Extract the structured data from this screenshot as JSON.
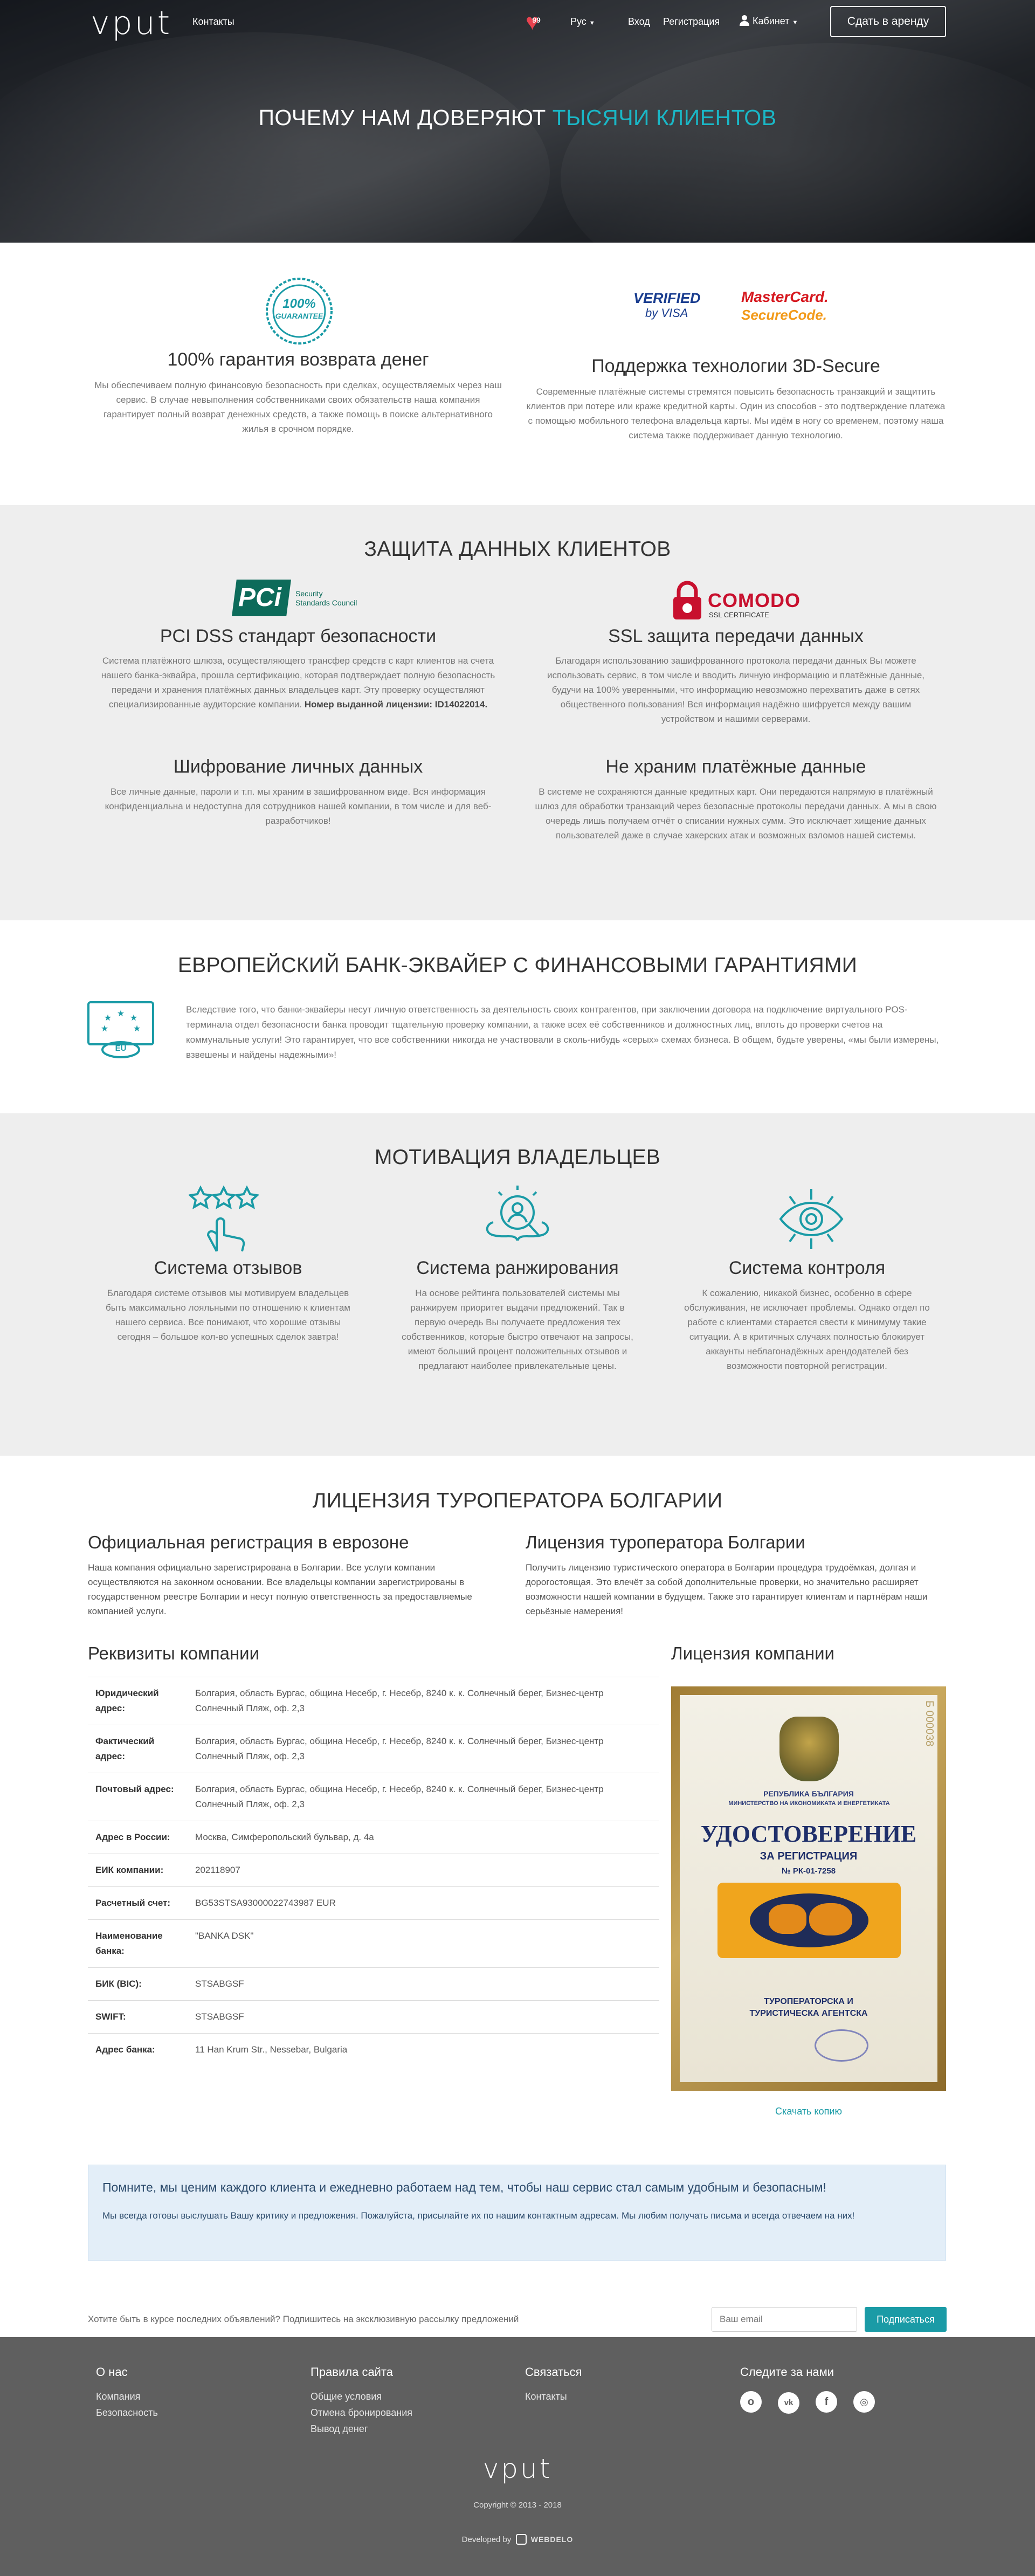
{
  "nav": {
    "logo": "vput",
    "contacts": "Контакты",
    "favorites_count": "99",
    "language": "Рус",
    "login": "Вход",
    "register": "Регистрация",
    "cabinet": "Кабинет",
    "rent_button": "Сдать в аренду"
  },
  "hero": {
    "title_main": "ПОЧЕМУ НАМ ДОВЕРЯЮТ ",
    "title_accent": "ТЫСЯЧИ КЛИЕНТОВ"
  },
  "guarantee": {
    "badge_top": "100%",
    "badge_bottom": "GUARANTEE",
    "title": "100% гарантия возврата денег",
    "text": "Мы обеспечиваем полную финансовую безопасность при сделках, осуществляемых через наш сервис. В случае невыполнения собственниками своих обязательств наша компания гарантирует полный возврат денежных средств, а также помощь в поиске альтернативного жилья в срочном порядке."
  },
  "secure3d": {
    "visa_line1": "VERIFIED",
    "visa_line2": "by VISA",
    "mc_line1": "MasterCard.",
    "mc_line2": "SecureCode.",
    "title": "Поддержка технологии 3D-Secure",
    "text": "Современные платёжные системы стремятся повысить безопасность транзакций и защитить клиентов при потере или краже кредитной карты. Один из способов - это подтверждение платежа с помощью мобильного телефона владельца карты. Мы идём в ногу со временем, поэтому наша система также поддерживает данную технологию."
  },
  "protection": {
    "title": "ЗАЩИТА ДАННЫХ КЛИЕНТОВ",
    "pci_logo": "PCi",
    "pci_sub1": "Security",
    "pci_sub2": "Standards Council",
    "pci_title": "PCI DSS стандарт безопасности",
    "pci_text": "Система платёжного шлюза, осуществляющего трансфер средств с карт клиентов на счета нашего банка-эквайра, прошла сертификацию, которая подтверждает полную безопасность передачи и хранения платёжных данных владельцев карт. Эту проверку осуществляют специализированные аудиторские компании.",
    "pci_license_label": "Номер выданной лицензии: ID14022014.",
    "comodo_logo": "COMODO",
    "comodo_sub": "SSL CERTIFICATE",
    "ssl_title": "SSL защита передачи данных",
    "ssl_text": "Благодаря использованию зашифрованного протокола передачи данных Вы можете использовать сервис, в том числе и вводить личную информацию и платёжные данные, будучи на 100% уверенными, что информацию невозможно перехватить даже в сетях общественного пользования! Вся информация надёжно шифруется между вашим устройством и нашими серверами.",
    "enc_title": "Шифрование личных данных",
    "enc_text": "Все личные данные, пароли и т.п. мы храним в зашифрованном виде. Вся информация конфиденциальна и недоступна для сотрудников нашей компании, в том числе и для веб-разработчиков!",
    "nostore_title": "Не храним платёжные данные",
    "nostore_text": "В системе не сохраняются данные кредитных карт. Они передаются напрямую в платёжный шлюз для обработки транзакций через безопасные протоколы передачи данных. А мы в свою очередь лишь получаем отчёт о списании нужных сумм. Это исключает хищение данных пользователей даже в случае хакерских атак и возможных взломов нашей системы."
  },
  "bank": {
    "title": "ЕВРОПЕЙСКИЙ БАНК-ЭКВАЙЕР С ФИНАНСОВЫМИ ГАРАНТИЯМИ",
    "eu_label": "EU",
    "text": "Вследствие того, что банки-эквайеры несут личную ответственность за деятельность своих контрагентов, при заключении договора на подключение виртуального POS-терминала отдел безопасности банка проводит тщательную проверку компании, а также всех её собственников и должностных лиц, вплоть до проверки счетов на коммунальные услуги! Это гарантирует, что все собственники никогда не участвовали в сколь-нибудь «серых» схемах бизнеса. В общем, будьте уверены, «мы были измерены, взвешены и найдены надежными»!"
  },
  "motivation": {
    "title": "МОТИВАЦИЯ ВЛАДЕЛЬЦЕВ",
    "items": [
      {
        "title": "Система отзывов",
        "text": "Благодаря системе отзывов мы мотивируем владельцев быть максимально лояльными по отношению к клиентам нашего сервиса. Все понимают, что хорошие отзывы сегодня – большое кол-во успешных сделок завтра!"
      },
      {
        "title": "Система ранжирования",
        "text": "На основе рейтинга пользователей системы мы ранжируем приоритет выдачи предложений. Так в первую очередь Вы получаете предложения тех собственников, которые быстро отвечают на запросы, имеют больший процент положительных отзывов и предлагают наиболее привлекательные цены."
      },
      {
        "title": "Система контроля",
        "text": "К сожалению, никакой бизнес, особенно в сфере обслуживания, не исключает проблемы. Однако отдел по работе с клиентами старается свести к минимуму такие ситуации. А в критичных случаях полностью блокирует аккаунты неблагонадёжных арендодателей без возможности повторной регистрации."
      }
    ]
  },
  "license": {
    "title": "ЛИЦЕНЗИЯ ТУРОПЕРАТОРА БОЛГАРИИ",
    "reg_title": "Официальная регистрация в еврозоне",
    "reg_text": "Наша компания официально зарегистрирована в Болгарии. Все услуги компании осуществляются на законном основании. Все владельцы компании зарегистрированы в государственном реестре Болгарии и несут полную ответственность за предоставляемые компанией услуги.",
    "op_title": "Лицензия туроператора Болгарии",
    "op_text": "Получить лицензию туристического оператора в Болгарии процедура трудоёмкая, долгая и дорогостоящая. Это влечёт за собой дополнительные проверки, но значительно расширяет возможности нашей компании в будущем. Также это гарантирует клиентам и партнёрам наши серьёзные намерения!",
    "req_title": "Реквизиты компании",
    "req_rows": [
      {
        "k": "Юридический адрес:",
        "v": "Болгария, область Бургас, община Несебр, г. Несебр, 8240 к. к. Солнечный берег, Бизнес-центр Солнечный Пляж, оф. 2,3"
      },
      {
        "k": "Фактический адрес:",
        "v": "Болгария, область Бургас, община Несебр, г. Несебр, 8240 к. к. Солнечный берег, Бизнес-центр Солнечный Пляж, оф. 2,3"
      },
      {
        "k": "Почтовый адрес:",
        "v": "Болгария, область Бургас, община Несебр, г. Несебр, 8240 к. к. Солнечный берег, Бизнес-центр Солнечный Пляж, оф. 2,3"
      },
      {
        "k": "Адрес в России:",
        "v": "Москва, Симферопольский бульвар, д. 4а"
      },
      {
        "k": "ЕИК компании:",
        "v": "202118907"
      },
      {
        "k": "Расчетный счет:",
        "v": "BG53STSA93000022743987 EUR"
      },
      {
        "k": "Наименование банка:",
        "v": "\"BANKA DSK\""
      },
      {
        "k": "БИК (BIC):",
        "v": "STSABGSF"
      },
      {
        "k": "SWIFT:",
        "v": "STSABGSF"
      },
      {
        "k": "Адрес банка:",
        "v": "11 Han Krum Str., Nessebar, Bulgaria"
      }
    ],
    "lic_title": "Лицензия компании",
    "doc_line1": "РЕПУБЛИКА БЪЛГАРИЯ",
    "doc_line2": "МИНИСТЕРСТВО НА ИКОНОМИКАТА И ЕНЕРГЕТИКАТА",
    "doc_heading": "УДОСТОВЕРЕНИЕ",
    "doc_sub": "ЗА РЕГИСТРАЦИЯ",
    "doc_num": "№ РК-01-7258",
    "doc_type1": "ТУРОПЕРАТОРСКА И",
    "doc_type2": "ТУРИСТИЧЕСКА АГЕНТСКА",
    "doc_serial": "Б 000038",
    "download": "Скачать копию"
  },
  "notice": {
    "title": "Помните, мы ценим каждого клиента и ежедневно работаем над тем, чтобы наш сервис стал самым удобным и безопасным!",
    "text": "Мы всегда готовы выслушать Вашу критику и предложения. Пожалуйста, присылайте их по нашим контактным адресам. Мы любим получать письма и всегда отвечаем на них!"
  },
  "subscribe": {
    "text": "Хотите быть в курсе последних объявлений? Подпишитесь на эксклюзивную рассылку предложений",
    "placeholder": "Ваш email",
    "button": "Подписаться"
  },
  "footer": {
    "about_title": "О нас",
    "about_links": [
      "Компания",
      "Безопасность"
    ],
    "rules_title": "Правила сайта",
    "rules_links": [
      "Общие условия",
      "Отмена бронирования",
      "Вывод денег"
    ],
    "contact_title": "Связаться",
    "contact_links": [
      "Контакты"
    ],
    "social_title": "Следите за нами",
    "social_icons": [
      "odnoklassniki-icon",
      "vk-icon",
      "facebook-icon",
      "instagram-icon"
    ],
    "logo": "vput",
    "copyright": "Copyright © 2013 - 2018",
    "developed_by": "Developed by",
    "developer": "WEBDELO"
  },
  "colors": {
    "accent": "#1ab7c6",
    "teal_icon": "#1a9ba6",
    "subscribe_button": "#1a9ba6",
    "footer_bg": "#5f5f5f",
    "notice_bg": "#e3eef8",
    "comodo_red": "#c8102e",
    "pci_green": "#0d6b5a"
  }
}
